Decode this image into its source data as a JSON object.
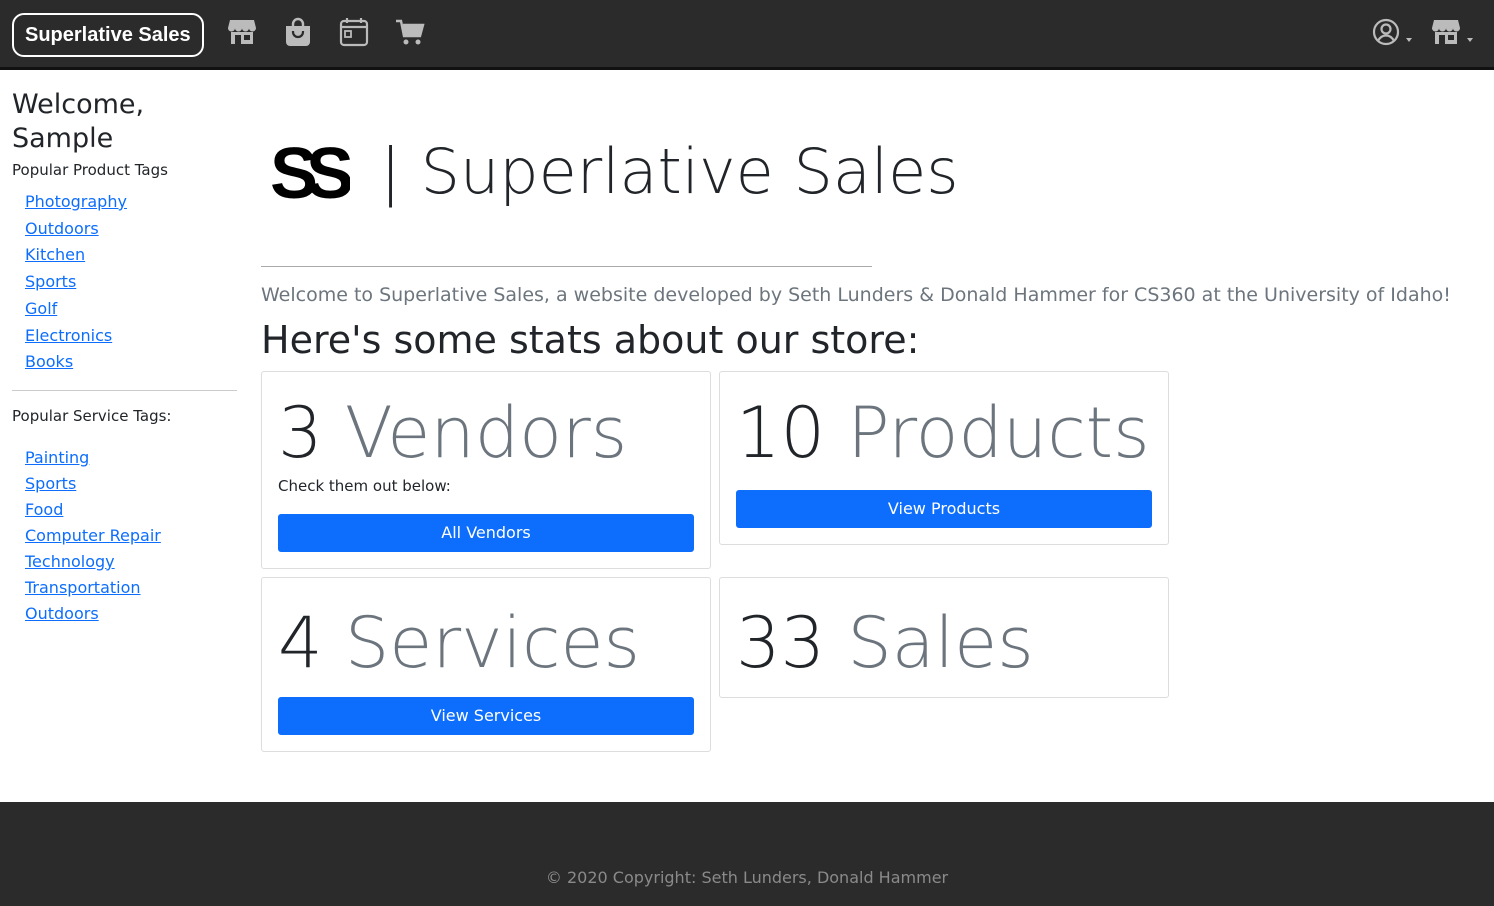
{
  "navbar": {
    "brand": "Superlative Sales",
    "icons": [
      "storefront-icon",
      "shopping-bag-icon",
      "calendar-icon",
      "cart-icon",
      "user-circle-icon",
      "store-menu-icon"
    ]
  },
  "sidebar": {
    "welcome": "Welcome, Sample",
    "product_tags_heading": "Popular Product Tags",
    "product_tags": [
      "Photography",
      "Outdoors",
      "Kitchen",
      "Sports",
      "Golf",
      "Electronics",
      "Books"
    ],
    "service_tags_heading": "Popular Service Tags:",
    "service_tags": [
      "Painting",
      "Sports",
      "Food",
      "Computer Repair",
      "Technology",
      "Transportation",
      "Outdoors"
    ]
  },
  "hero": {
    "logo_text": "SS",
    "title": "| Superlative Sales",
    "lead": "Welcome to Superlative Sales, a website developed by Seth Lunders & Donald Hammer for CS360 at the University of Idaho!",
    "stats_heading": "Here's some stats about our store:"
  },
  "stats": {
    "vendors": {
      "count": "3",
      "unit": "Vendors",
      "sub": "Check them out below:",
      "button": "All Vendors"
    },
    "products": {
      "count": "10",
      "unit": "Products",
      "button": "View Products"
    },
    "services": {
      "count": "4",
      "unit": "Services",
      "button": "View Services"
    },
    "sales": {
      "count": "33",
      "unit": "Sales"
    }
  },
  "footer": {
    "copyright": "© 2020 Copyright: Seth Lunders, Donald Hammer"
  },
  "colors": {
    "navbar_bg": "#2b2b2b",
    "primary": "#0d6efd",
    "muted": "#6c757d"
  }
}
